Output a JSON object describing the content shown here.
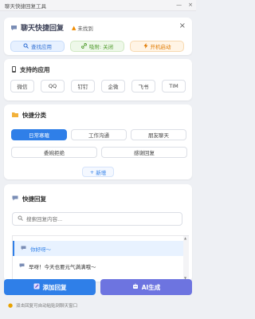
{
  "window": {
    "title": "聊天快捷回复工具",
    "minimize": "—",
    "close": "×"
  },
  "header": {
    "title": "聊天快捷回复",
    "status": "未找到",
    "close": "×",
    "buttons": {
      "find": "查找应用",
      "attach": "吸附: 关闭",
      "autostart": "开机启动"
    }
  },
  "apps": {
    "title": "支持的应用",
    "items": [
      "微信",
      "QQ",
      "钉钉",
      "企微",
      "飞书",
      "TIM"
    ]
  },
  "categories": {
    "title": "快捷分类",
    "items": [
      "日常寒暄",
      "工作沟通",
      "朋友聊天",
      "委婉拒绝",
      "感谢回复"
    ],
    "add": "新增"
  },
  "replies": {
    "title": "快捷回复",
    "search_placeholder": "搜索回复内容...",
    "items": [
      "你好呀～",
      "早呀！今天也要元气满满哦～"
    ]
  },
  "actions": {
    "add": "添加回复",
    "ai": "AI生成"
  },
  "tip": "双击回复可自动粘贴到聊天窗口",
  "colors": {
    "primary": "#2f7fe8",
    "ai": "#6d74e0",
    "warning": "#f08c00",
    "success": "#4e9a2a"
  }
}
